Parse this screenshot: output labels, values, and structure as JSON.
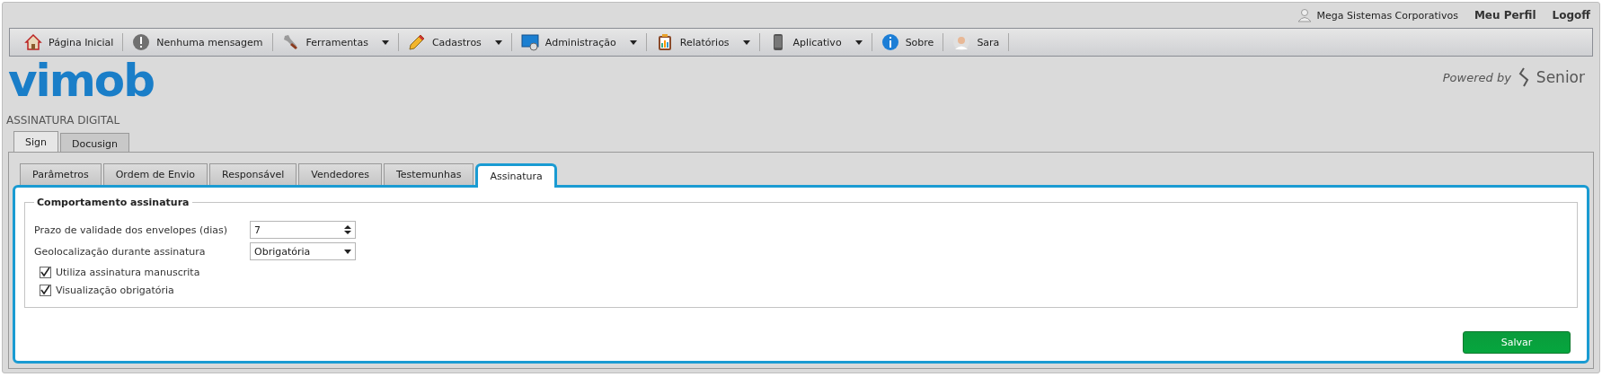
{
  "user_bar": {
    "user": "Mega Sistemas Corporativos",
    "links": [
      "Meu Perfil",
      "Logoff"
    ]
  },
  "menu": [
    {
      "kind": "home",
      "label": "Página Inicial",
      "dropdown": false
    },
    {
      "kind": "alert",
      "label": "Nenhuma mensagem",
      "dropdown": false
    },
    {
      "kind": "wrench",
      "label": "Ferramentas",
      "dropdown": true
    },
    {
      "kind": "pencil",
      "label": "Cadastros",
      "dropdown": true
    },
    {
      "kind": "monitor",
      "label": "Administração",
      "dropdown": true
    },
    {
      "kind": "clipboard",
      "label": "Relatórios",
      "dropdown": true
    },
    {
      "kind": "phone",
      "label": "Aplicativo",
      "dropdown": true
    },
    {
      "kind": "info",
      "label": "Sobre",
      "dropdown": false
    },
    {
      "kind": "person",
      "label": "Sara",
      "dropdown": false
    }
  ],
  "logo": "vimob",
  "powered_by": "Powered by",
  "brand": "Senior",
  "page_title": "ASSINATURA DIGITAL",
  "outer_tabs": [
    {
      "label": "Sign",
      "selected": true
    },
    {
      "label": "Docusign",
      "selected": false
    }
  ],
  "inner_tabs": [
    {
      "label": "Parâmetros",
      "selected": false
    },
    {
      "label": "Ordem de Envio",
      "selected": false
    },
    {
      "label": "Responsável",
      "selected": false
    },
    {
      "label": "Vendedores",
      "selected": false
    },
    {
      "label": "Testemunhas",
      "selected": false
    },
    {
      "label": "Assinatura",
      "selected": true
    }
  ],
  "fieldset": {
    "legend": "Comportamento assinatura",
    "fields": [
      {
        "kind": "spinner",
        "label": "Prazo de validade dos envelopes (dias)",
        "value": "7"
      },
      {
        "kind": "select",
        "label": "Geolocalização durante assinatura",
        "value": "Obrigatória"
      }
    ],
    "checkboxes": [
      {
        "label": "Utiliza assinatura manuscrita",
        "checked": true
      },
      {
        "label": "Visualização obrigatória",
        "checked": true
      }
    ]
  },
  "save_button": "Salvar"
}
